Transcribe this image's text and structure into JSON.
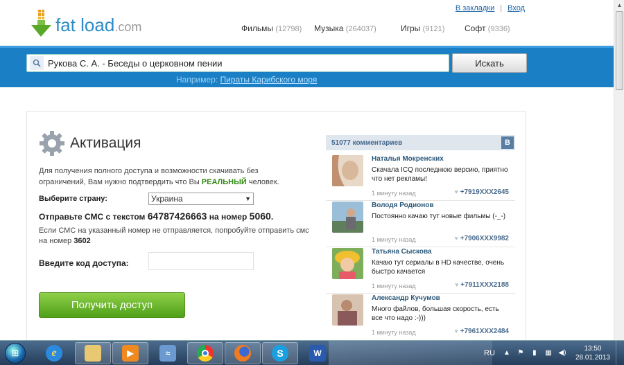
{
  "header": {
    "logo": {
      "fat": "fat",
      "load": "load",
      "com": ".com"
    },
    "links": {
      "bookmarks": "В закладки",
      "divider": "|",
      "login": "Вход"
    },
    "nav": [
      {
        "label": "Фильмы",
        "count": "(12798)"
      },
      {
        "label": "Музыка",
        "count": "(264037)"
      },
      {
        "label": "Игры",
        "count": "(9121)"
      },
      {
        "label": "Софт",
        "count": "(9336)"
      }
    ]
  },
  "search": {
    "value": "Рукова С. А. - Беседы о церковном пении",
    "button": "Искать",
    "example_label": "Например:",
    "example_link": "Пираты Карибского моря"
  },
  "activation": {
    "title": "Активация",
    "desc_pre": "Для получения полного доступа и возможности скачивать без ограничений, Вам нужно подтвердить что Вы",
    "desc_bold": "РЕАЛЬНЫЙ",
    "desc_post": "человек.",
    "country_label": "Выберите страну:",
    "country_value": "Украина",
    "sms_pre": "Отправьте СМС с текстом",
    "sms_code": "64787426663",
    "sms_mid": "на номер",
    "sms_number": "5060",
    "sms_dot": ".",
    "note_pre": "Если СМС на указанный номер не отправляется, попробуйте отправить смс на номер",
    "note_number": "3602",
    "code_label": "Введите код доступа:",
    "button": "Получить доступ"
  },
  "comments": {
    "header": "51077 комментариев",
    "vk": "В",
    "items": [
      {
        "name": "Наталья Мокренских",
        "text": "Скачала ICQ последнюю версию, приятно что нет рекламы!",
        "time": "1 минуту назад",
        "phone": "+7919XXX2645"
      },
      {
        "name": "Володя Родионов",
        "text": "Постоянно качаю тут новые фильмы (-_-)",
        "time": "1 минуту назад",
        "phone": "+7906XXX9982"
      },
      {
        "name": "Татьяна Сыскова",
        "text": "Качаю тут сериалы в HD качестве, очень быстро качается",
        "time": "1 минуту назад",
        "phone": "+7911XXX2188"
      },
      {
        "name": "Александр Кучумов",
        "text": "Много файлов, большая скорость, есть все что надо :-)))",
        "time": "1 минуту назад",
        "phone": "+7961XXX2484"
      }
    ]
  },
  "taskbar": {
    "lang": "RU",
    "time": "13:50",
    "date": "28.01.2013",
    "apps": [
      "ie",
      "explorer",
      "media-player",
      "ie-alt",
      "chrome",
      "firefox",
      "skype",
      "word"
    ]
  },
  "colors": {
    "brand_blue": "#1a7fc4",
    "green": "#4fa01a",
    "vk_blue": "#597da3"
  }
}
